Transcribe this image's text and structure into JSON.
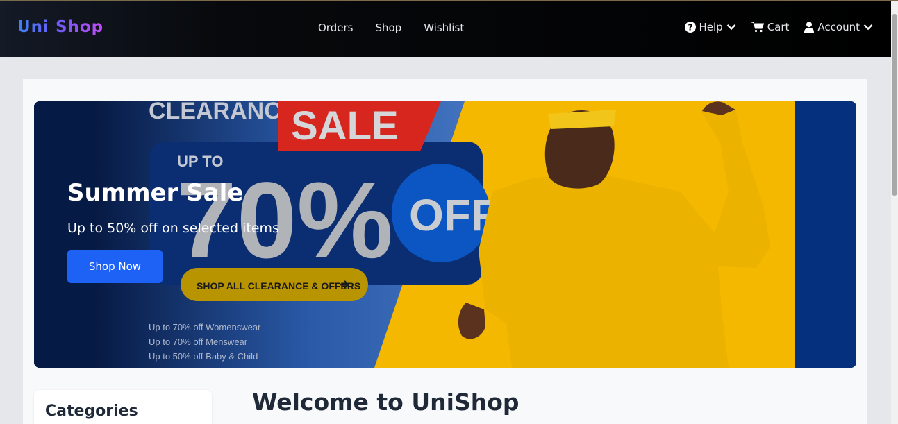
{
  "brand": {
    "name": "Uni Shop"
  },
  "nav": {
    "links": [
      {
        "label": "Orders"
      },
      {
        "label": "Shop"
      },
      {
        "label": "Wishlist"
      }
    ],
    "help_label": "Help",
    "cart_label": "Cart",
    "account_label": "Account"
  },
  "hero": {
    "title": "Summer Sale",
    "subtitle": "Up to 50% off on selected items",
    "button_label": "Shop Now",
    "banner": {
      "clearance": "CLEARANCE",
      "sale": "SALE",
      "up_to": "UP TO",
      "percent": "70%",
      "off": "OFF",
      "cta": "SHOP ALL CLEARANCE & OFFERS",
      "lines": [
        "Up to 70% off Womenswear",
        "Up to 70% off Menswear",
        "Up to 50% off Baby & Child"
      ]
    }
  },
  "sidebar": {
    "categories_title": "Categories"
  },
  "main": {
    "welcome_heading": "Welcome to UniShop"
  },
  "colors": {
    "primary_button": "#1d62f4",
    "navbar_bg": "#000000",
    "banner_yellow": "#f5b800",
    "banner_blue": "#0d2c6e"
  }
}
